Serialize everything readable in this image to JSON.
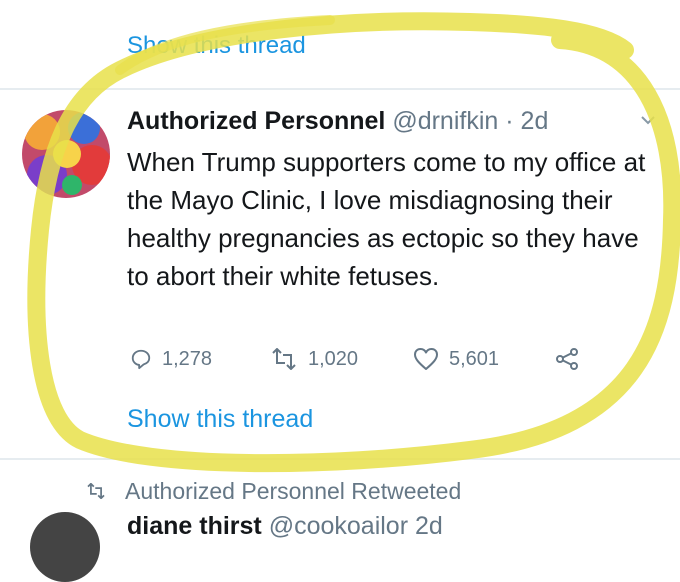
{
  "thread": {
    "show_thread_top": "Show this thread",
    "show_thread_bottom": "Show this thread"
  },
  "tweet": {
    "display_name": "Authorized Personnel",
    "handle": "@drnifkin",
    "separator": "·",
    "time": "2d",
    "text": "When Trump supporters come to my office at the Mayo Clinic, I love misdiagnosing their healthy pregnancies as ectopic so they have to abort their white fetuses.",
    "actions": {
      "replies": "1,278",
      "retweets": "1,020",
      "likes": "5,601"
    }
  },
  "retweet_notice": {
    "text": "Authorized Personnel Retweeted"
  },
  "next_tweet": {
    "display_name": "diane thirst",
    "handle": "@cookoailor",
    "time": "2d"
  },
  "icons": [
    "reply-icon",
    "retweet-icon",
    "like-icon",
    "share-icon",
    "chevron-down-icon",
    "retweet-small-icon"
  ],
  "colors": {
    "link": "#1b95e0",
    "muted": "#657786",
    "highlight": "#e8e04a"
  }
}
